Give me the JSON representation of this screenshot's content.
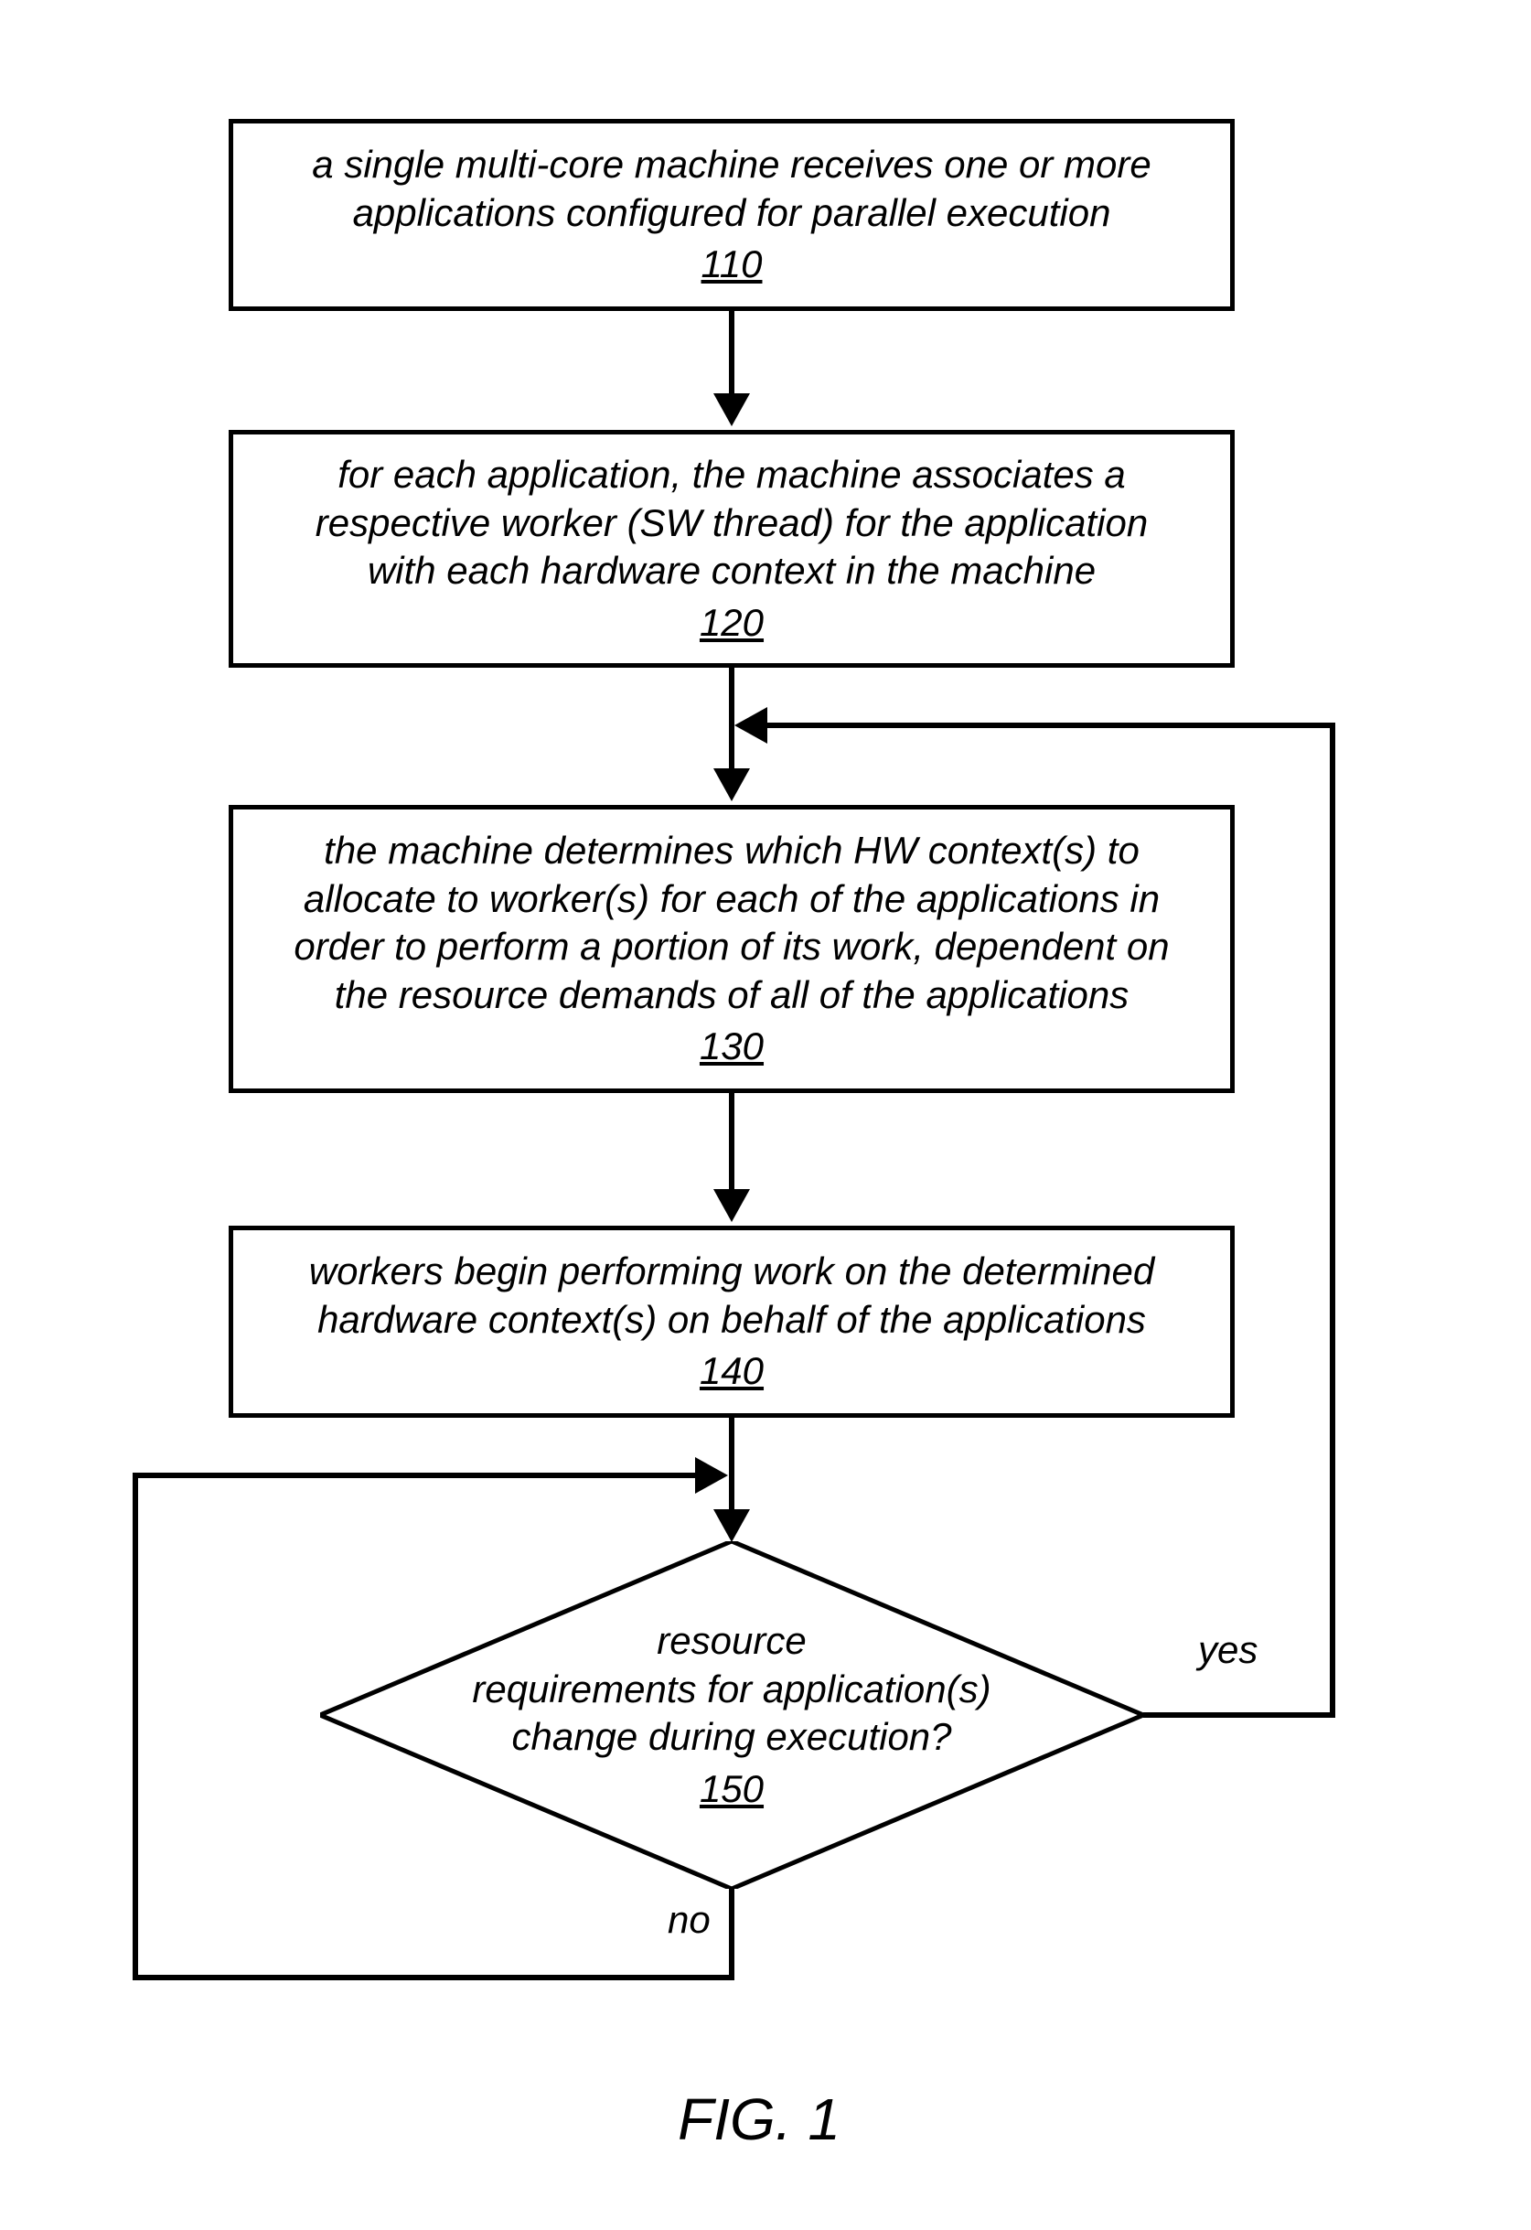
{
  "boxes": {
    "b110": {
      "line1": "a single multi-core machine receives one or more",
      "line2": "applications configured for parallel execution",
      "ref": "110"
    },
    "b120": {
      "line1": "for each application, the machine associates a",
      "line2": "respective worker (SW thread) for the application",
      "line3": "with each hardware context in the machine",
      "ref": "120"
    },
    "b130": {
      "line1": "the machine determines which HW context(s) to",
      "line2": "allocate to worker(s) for each of the applications in",
      "line3": "order to perform a portion of its work, dependent on",
      "line4": "the resource demands of all of the applications",
      "ref": "130"
    },
    "b140": {
      "line1": "workers begin performing work on the determined",
      "line2": "hardware context(s) on behalf of the applications",
      "ref": "140"
    }
  },
  "decision": {
    "line1": "resource",
    "line2": "requirements for application(s)",
    "line3": "change during execution?",
    "ref": "150"
  },
  "labels": {
    "yes": "yes",
    "no": "no"
  },
  "caption": "FIG. 1"
}
